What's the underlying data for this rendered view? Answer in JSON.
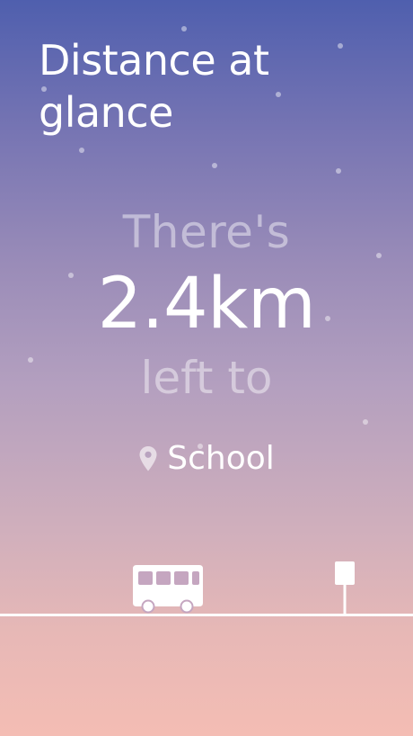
{
  "header": {
    "title": "Distance at glance"
  },
  "distance": {
    "pre_text": "There's",
    "value": "2.4km",
    "post_text": "left to"
  },
  "destination": {
    "icon": "location-pin-icon",
    "label": "School"
  },
  "illustration": {
    "vehicle_icon": "bus-icon",
    "stop_icon": "bus-stop-sign-icon"
  },
  "colors": {
    "gradient_top": "#4f5fae",
    "gradient_bottom": "#f4bdb4",
    "text": "#ffffff"
  }
}
